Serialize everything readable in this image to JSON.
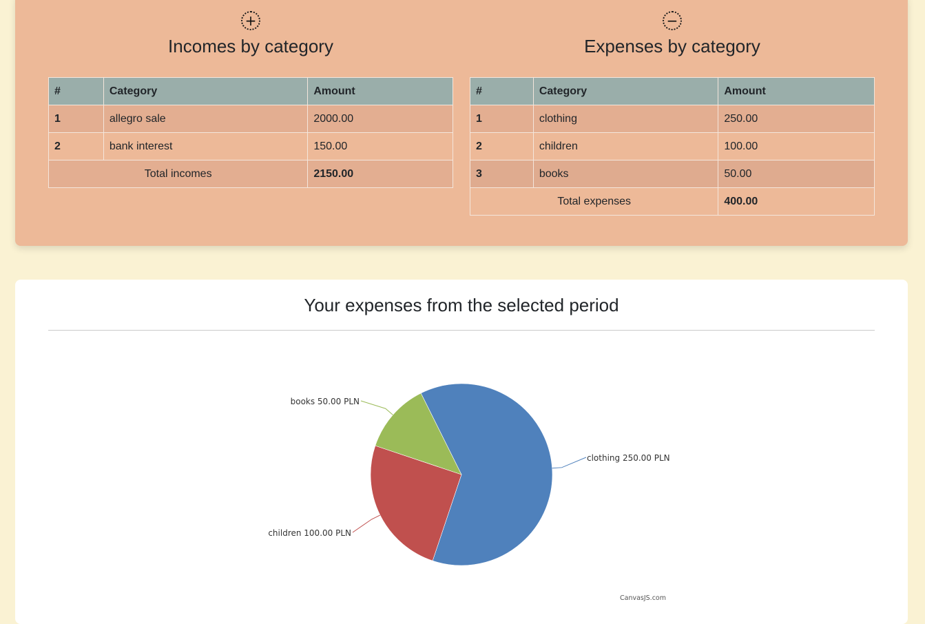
{
  "incomes": {
    "icon": "plus-circle-icon",
    "title": "Incomes by category",
    "columns": [
      "#",
      "Category",
      "Amount"
    ],
    "rows": [
      {
        "idx": "1",
        "category": "allegro sale",
        "amount": "2000.00"
      },
      {
        "idx": "2",
        "category": "bank interest",
        "amount": "150.00"
      }
    ],
    "total_label": "Total incomes",
    "total_value": "2150.00"
  },
  "expenses": {
    "icon": "minus-circle-icon",
    "title": "Expenses by category",
    "columns": [
      "#",
      "Category",
      "Amount"
    ],
    "rows": [
      {
        "idx": "1",
        "category": "clothing",
        "amount": "250.00"
      },
      {
        "idx": "2",
        "category": "children",
        "amount": "100.00"
      },
      {
        "idx": "3",
        "category": "books",
        "amount": "50.00"
      }
    ],
    "total_label": "Total expenses",
    "total_value": "400.00"
  },
  "chart": {
    "heading": "Your expenses from the selected period",
    "credit": "CanvasJS.com"
  },
  "chart_data": {
    "type": "pie",
    "title": "Your expenses from the selected period",
    "slices": [
      {
        "label": "clothing",
        "value": 250.0,
        "display": "clothing 250.00 PLN",
        "color": "#4f81bc"
      },
      {
        "label": "children",
        "value": 100.0,
        "display": "children 100.00 PLN",
        "color": "#c0504e"
      },
      {
        "label": "books",
        "value": 50.0,
        "display": "books 50.00 PLN",
        "color": "#9bbb58"
      }
    ],
    "unit": "PLN"
  },
  "colors": {
    "page_bg": "#faf2d3",
    "summary_card_bg": "#edb998",
    "table_header_bg": "#9aaeaa"
  }
}
